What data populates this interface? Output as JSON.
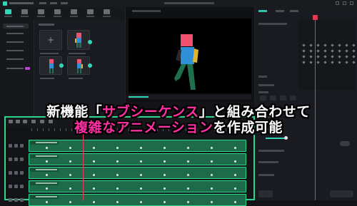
{
  "caption": {
    "line1_prefix": "新機能「",
    "line1_highlight": "サブシーケンス",
    "line1_suffix": "」と組み合わせて",
    "line2_highlight": "複雑なアニメーション",
    "line2_suffix": "を作成可能"
  },
  "colors": {
    "accent": "#31d6b8",
    "timeline_clip": "#1d6b4b",
    "timeline_border": "#2fd58b",
    "playhead": "#e23b5a",
    "caption_highlight": "#ff2fa4",
    "figure_head": "#f0516e",
    "figure_shirt": "#2f8fd8",
    "figure_arm": "#e0b52a",
    "figure_legs": "#1f6e4e"
  },
  "preview": {
    "scrub_progress": 0.16
  },
  "timeline": {
    "track_count": 5
  }
}
